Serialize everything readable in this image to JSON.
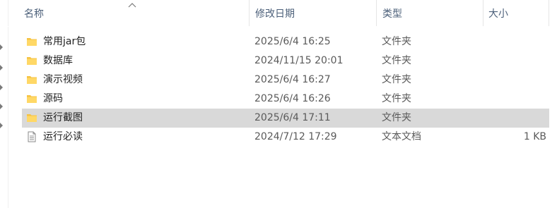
{
  "header": {
    "name_label": "名称",
    "date_label": "修改日期",
    "type_label": "类型",
    "size_label": "大小"
  },
  "files": [
    {
      "name": "常用jar包",
      "date": "2025/6/4 16:25",
      "type": "文件夹",
      "size": "",
      "icon": "folder-icon",
      "selected": false
    },
    {
      "name": "数据库",
      "date": "2024/11/15 20:01",
      "type": "文件夹",
      "size": "",
      "icon": "folder-icon",
      "selected": false
    },
    {
      "name": "演示视频",
      "date": "2025/6/4 16:27",
      "type": "文件夹",
      "size": "",
      "icon": "folder-icon",
      "selected": false
    },
    {
      "name": "源码",
      "date": "2025/6/4 16:26",
      "type": "文件夹",
      "size": "",
      "icon": "folder-icon",
      "selected": false
    },
    {
      "name": "运行截图",
      "date": "2025/6/4 17:11",
      "type": "文件夹",
      "size": "",
      "icon": "folder-icon",
      "selected": true
    },
    {
      "name": "运行必读",
      "date": "2024/7/12 17:29",
      "type": "文本文档",
      "size": "1 KB",
      "icon": "text-file-icon",
      "selected": false
    }
  ],
  "colors": {
    "header_text": "#4c607a",
    "selection": "#d9d9d9",
    "folder": "#f5c242"
  }
}
